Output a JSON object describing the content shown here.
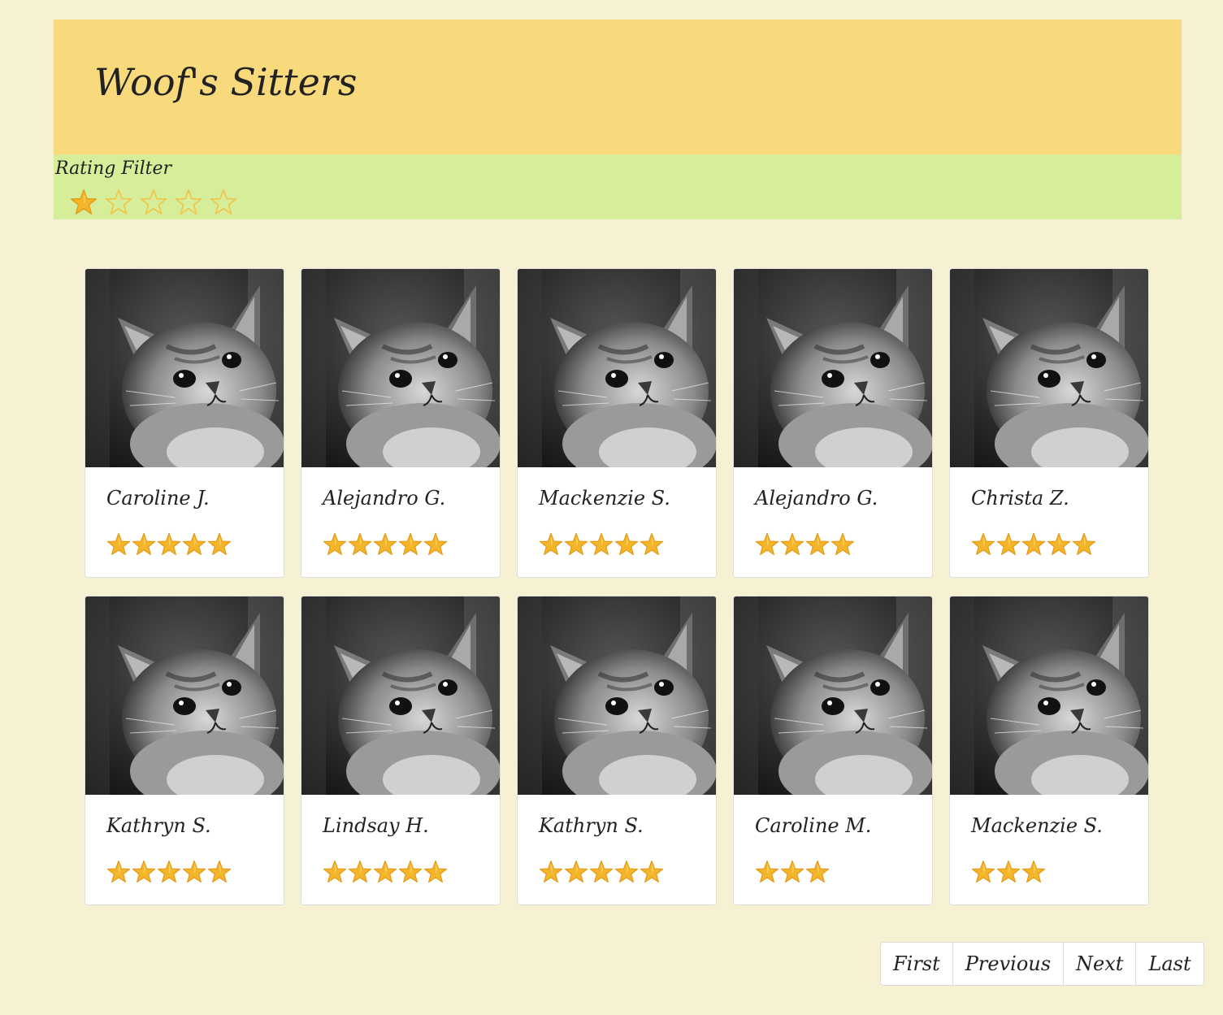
{
  "app": {
    "title": "Woof's Sitters"
  },
  "filter": {
    "label": "Rating Filter",
    "selected_rating": 1,
    "max_rating": 5
  },
  "colors": {
    "background": "#f7f1d3",
    "header": "#f8da7d",
    "filter_bar": "#d6ee9a",
    "star_fill": "#f4b52a",
    "star_outline": "#f1c54a"
  },
  "sitters": [
    {
      "name": "Caroline J.",
      "rating": 5,
      "photo_icon": "kitten-photo"
    },
    {
      "name": "Alejandro G.",
      "rating": 5,
      "photo_icon": "kitten-photo"
    },
    {
      "name": "Mackenzie S.",
      "rating": 5,
      "photo_icon": "kitten-photo"
    },
    {
      "name": "Alejandro G.",
      "rating": 4,
      "photo_icon": "kitten-photo"
    },
    {
      "name": "Christa Z.",
      "rating": 5,
      "photo_icon": "kitten-photo"
    },
    {
      "name": "Kathryn S.",
      "rating": 5,
      "photo_icon": "kitten-photo"
    },
    {
      "name": "Lindsay H.",
      "rating": 5,
      "photo_icon": "kitten-photo"
    },
    {
      "name": "Kathryn S.",
      "rating": 5,
      "photo_icon": "kitten-photo"
    },
    {
      "name": "Caroline M.",
      "rating": 3,
      "photo_icon": "kitten-photo"
    },
    {
      "name": "Mackenzie S.",
      "rating": 3,
      "photo_icon": "kitten-photo"
    }
  ],
  "pagination": {
    "first": "First",
    "previous": "Previous",
    "next": "Next",
    "last": "Last"
  }
}
